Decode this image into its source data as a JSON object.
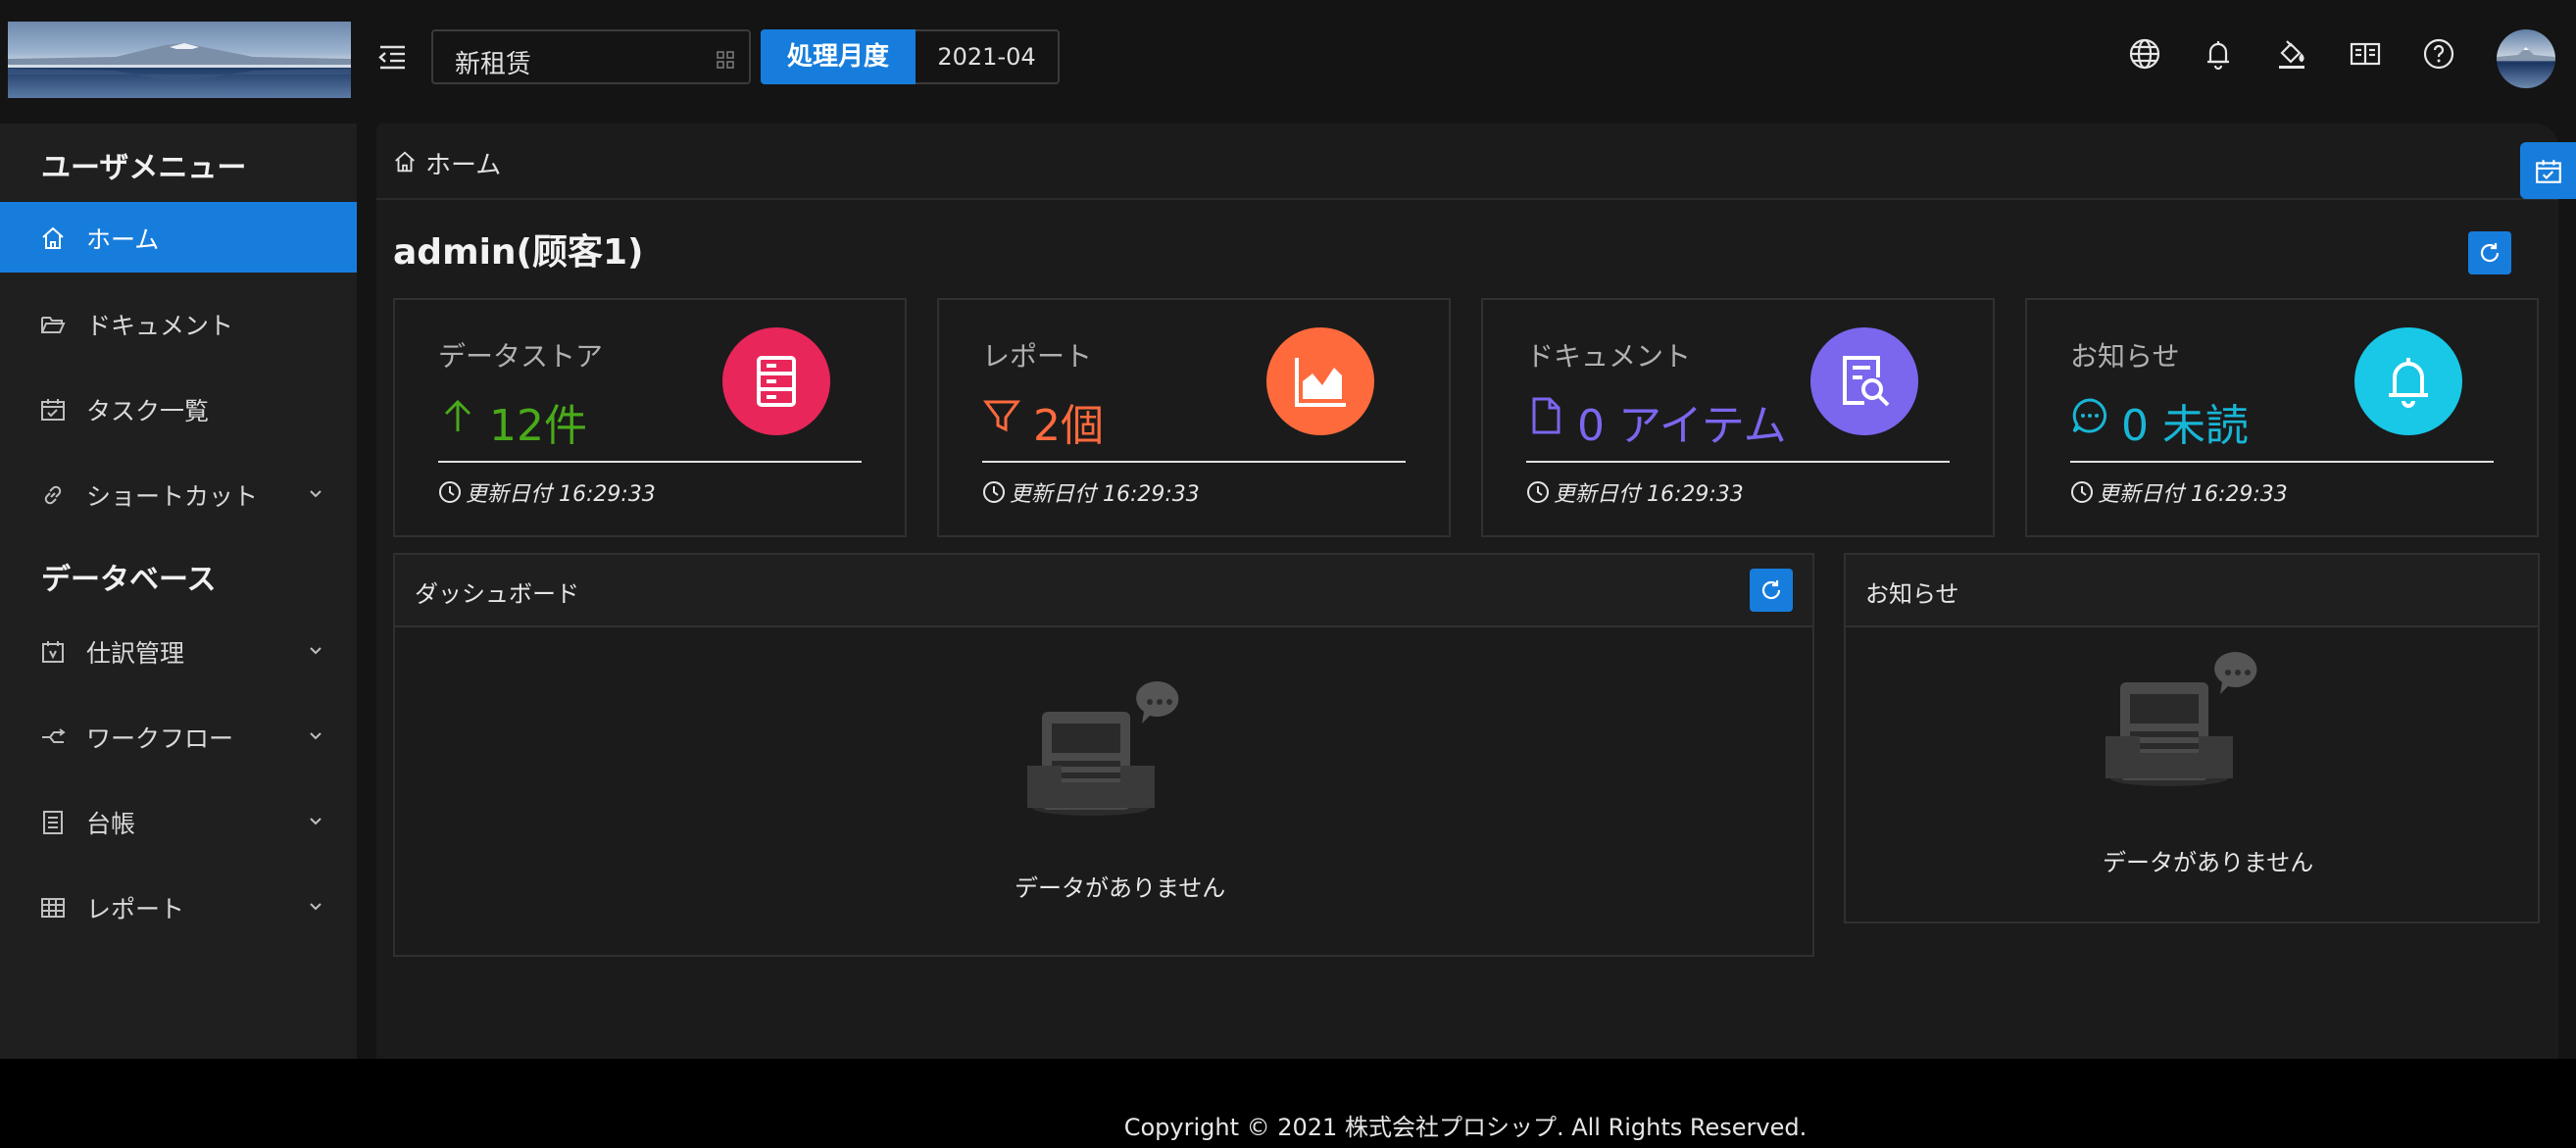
{
  "header": {
    "company": "新租赁",
    "period_label": "処理月度",
    "period_value": "2021-04",
    "icons": [
      "menu-fold-icon",
      "globe-icon",
      "bell-icon",
      "paint-bucket-icon",
      "book-icon",
      "question-icon"
    ]
  },
  "sidebar": {
    "user_menu_title": "ユーザメニュー",
    "database_title": "データベース",
    "items": [
      {
        "label": "ホーム",
        "icon": "home-icon",
        "active": true
      },
      {
        "label": "ドキュメント",
        "icon": "folder-open-icon"
      },
      {
        "label": "タスク一覧",
        "icon": "calendar-check-icon"
      },
      {
        "label": "ショートカット",
        "icon": "link-icon",
        "expandable": true
      },
      {
        "label": "仕訳管理",
        "icon": "schedule-icon",
        "expandable": true
      },
      {
        "label": "ワークフロー",
        "icon": "workflow-icon",
        "expandable": true
      },
      {
        "label": "台帳",
        "icon": "ledger-icon",
        "expandable": true
      },
      {
        "label": "レポート",
        "icon": "table-icon",
        "expandable": true
      }
    ]
  },
  "breadcrumb": {
    "home": "ホーム"
  },
  "page": {
    "title": "admin(顾客1)"
  },
  "cards": [
    {
      "title": "データストア",
      "value": "12件",
      "value_icon": "arrow-up-icon",
      "color": "#49aa19",
      "circle_color": "#e8265a",
      "icon": "database-icon",
      "updated": "更新日付 16:29:33"
    },
    {
      "title": "レポート",
      "value": "2個",
      "value_icon": "funnel-icon",
      "color": "#ff6a3d",
      "circle_color": "#ff6a3d",
      "icon": "area-chart-icon",
      "updated": "更新日付 16:29:33"
    },
    {
      "title": "ドキュメント",
      "value": "0 アイテム",
      "value_icon": "file-icon",
      "color": "#7a67ee",
      "circle_color": "#7a67ee",
      "icon": "file-search-icon",
      "updated": "更新日付 16:29:33"
    },
    {
      "title": "お知らせ",
      "value": "0 未読",
      "value_icon": "message-icon",
      "color": "#18b6d6",
      "circle_color": "#18c8e6",
      "icon": "bell-icon",
      "updated": "更新日付 16:29:33"
    }
  ],
  "dashboard": {
    "title": "ダッシュボード",
    "empty": "データがありません"
  },
  "notices": {
    "title": "お知らせ",
    "empty": "データがありません"
  },
  "footer": {
    "copyright": "Copyright © 2021 株式会社プロシップ. All Rights Reserved."
  },
  "colors": {
    "accent": "#177ddc",
    "background": "#141414",
    "panel": "#1b1b1b"
  }
}
